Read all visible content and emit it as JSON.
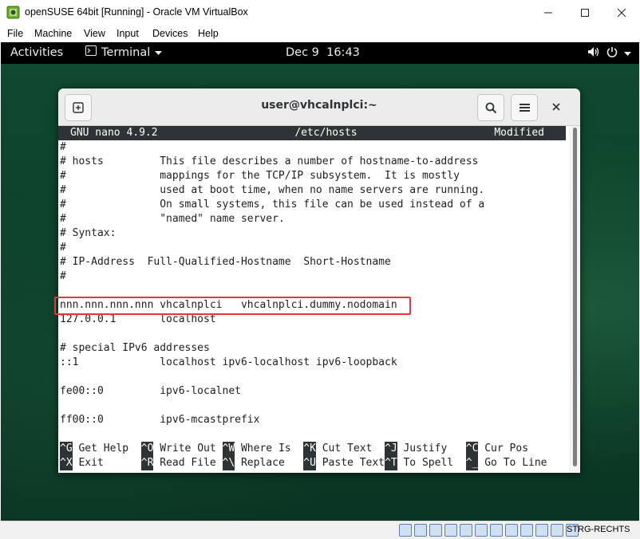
{
  "vbox": {
    "title": "openSUSE 64bit [Running] - Oracle VM VirtualBox",
    "menu": [
      "File",
      "Machine",
      "View",
      "Input",
      "Devices",
      "Help"
    ],
    "host_key": "STRG-RECHTS"
  },
  "gnome": {
    "activities": "Activities",
    "app_menu": "Terminal",
    "clock": "Dec 9  16:43",
    "status_icons": [
      "volume-icon",
      "power-icon"
    ]
  },
  "terminal": {
    "title": "user@vhcalnplci:~",
    "nano": {
      "version": "GNU nano 4.9.2",
      "file": "/etc/hosts",
      "state": "Modified",
      "lines": [
        "#",
        "# hosts         This file describes a number of hostname-to-address",
        "#               mappings for the TCP/IP subsystem.  It is mostly",
        "#               used at boot time, when no name servers are running.",
        "#               On small systems, this file can be used instead of a",
        "#               \"named\" name server.",
        "# Syntax:",
        "#",
        "# IP-Address  Full-Qualified-Hostname  Short-Hostname",
        "#",
        "",
        "nnn.nnn.nnn.nnn vhcalnplci   vhcalnplci.dummy.nodomain",
        "127.0.0.1       localhost",
        "",
        "# special IPv6 addresses",
        "::1             localhost ipv6-localhost ipv6-loopback",
        "",
        "fe00::0         ipv6-localnet",
        "",
        "ff00::0         ipv6-mcastprefix",
        ""
      ],
      "shortcuts_row1": [
        {
          "key": "^G",
          "label": " Get Help  "
        },
        {
          "key": "^O",
          "label": " Write Out "
        },
        {
          "key": "^W",
          "label": " Where Is  "
        },
        {
          "key": "^K",
          "label": " Cut Text  "
        },
        {
          "key": "^J",
          "label": " Justify   "
        },
        {
          "key": "^C",
          "label": " Cur Pos"
        }
      ],
      "shortcuts_row2": [
        {
          "key": "^X",
          "label": " Exit      "
        },
        {
          "key": "^R",
          "label": " Read File "
        },
        {
          "key": "^\\",
          "label": " Replace   "
        },
        {
          "key": "^U",
          "label": " Paste Text"
        },
        {
          "key": "^T",
          "label": " To Spell  "
        },
        {
          "key": "^_",
          "label": " Go To Line"
        }
      ]
    }
  },
  "colors": {
    "highlight": "#e2373f",
    "nano_bar": "#2e3436",
    "desktop": "#0c3a26"
  }
}
